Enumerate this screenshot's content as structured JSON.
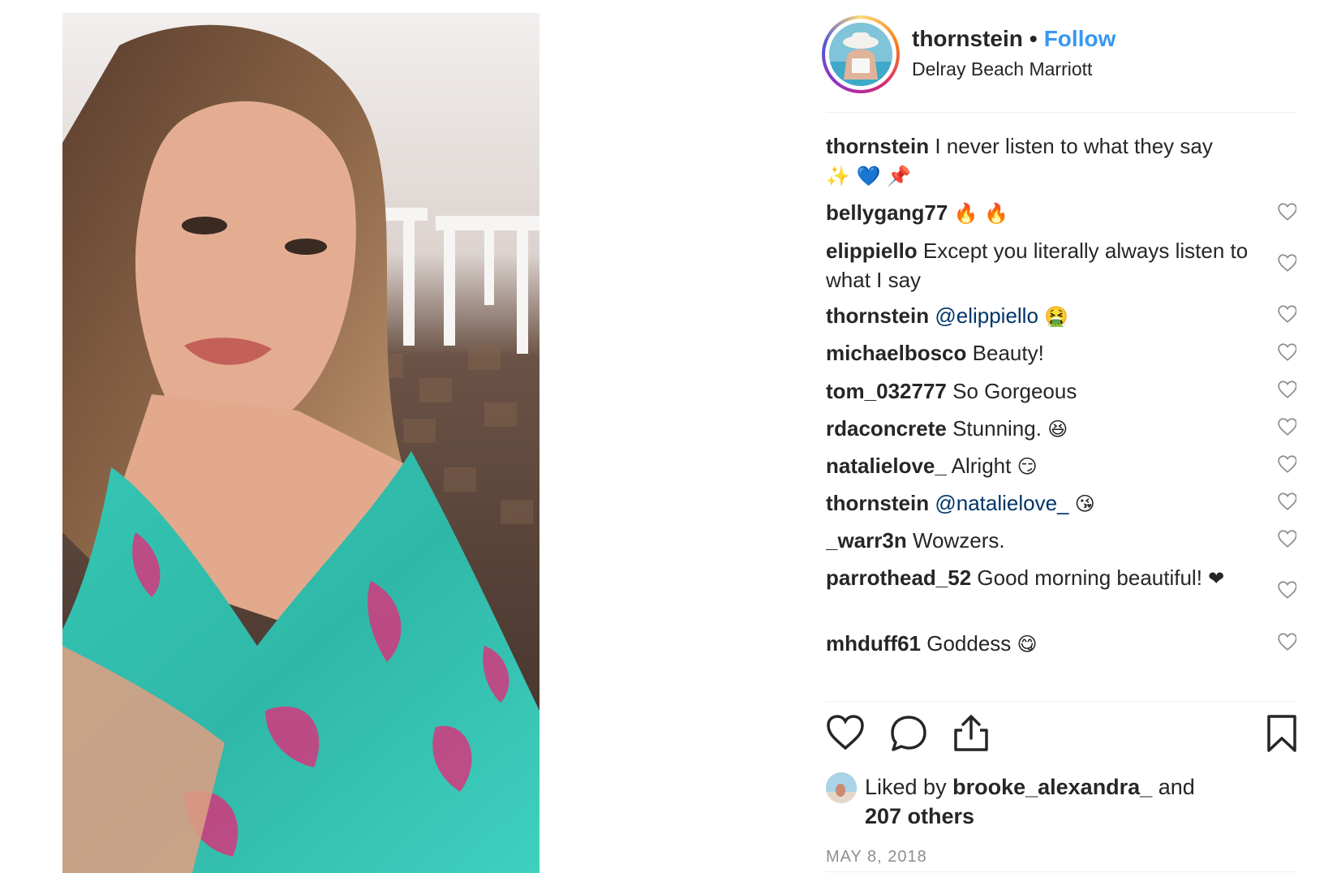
{
  "post": {
    "username": "thornstein",
    "separator": "•",
    "follow_label": "Follow",
    "location": "Delray Beach Marriott"
  },
  "caption": {
    "username": "thornstein",
    "text": "I never listen to what they say",
    "emojis": "✨ 💙 📌"
  },
  "comments": [
    {
      "user": "bellygang77",
      "text": "",
      "emoji": "🔥 🔥"
    },
    {
      "user": "elippiello",
      "text": "Except you literally always listen to what I say",
      "emoji": ""
    },
    {
      "user": "thornstein",
      "mention": "@elippiello",
      "text": "",
      "emoji": "🤮"
    },
    {
      "user": "michaelbosco",
      "text": "Beauty!",
      "emoji": ""
    },
    {
      "user": "tom_032777",
      "text": "So Gorgeous",
      "emoji": ""
    },
    {
      "user": "rdaconcrete",
      "text": "Stunning.",
      "emoji": "😆"
    },
    {
      "user": "natalielove_",
      "text": "Alright",
      "emoji": "😏"
    },
    {
      "user": "thornstein",
      "mention": "@natalielove_",
      "text": "",
      "emoji": "😘"
    },
    {
      "user": "_warr3n",
      "text": "Wowzers.",
      "emoji": ""
    },
    {
      "user": "parrothead_52",
      "text": "Good morning beautiful!",
      "emoji": "❤"
    },
    {
      "user": "mhduff61",
      "text": "Goddess",
      "emoji": "😋"
    }
  ],
  "likes": {
    "prefix": "Liked by",
    "user": "brooke_alexandra_",
    "middle": "and",
    "others": "207 others"
  },
  "date": "MAY 8, 2018",
  "icons": {
    "like": "heart-icon",
    "comment": "comment-bubble-icon",
    "share": "share-icon",
    "save": "bookmark-icon",
    "comment_like": "heart-outline-icon"
  }
}
